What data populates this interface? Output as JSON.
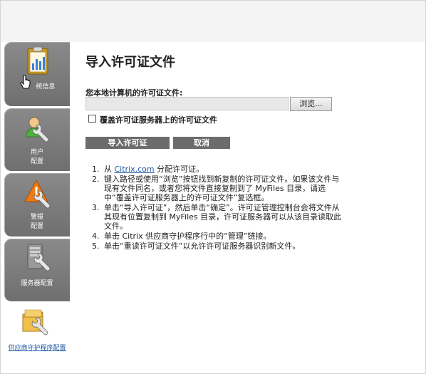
{
  "sidebar": {
    "items": [
      {
        "label": "统信息",
        "icon": "clipboard-chart-icon"
      },
      {
        "label1": "用户",
        "label2": "配置",
        "icon": "user-wrench-icon"
      },
      {
        "label1": "警报",
        "label2": "配置",
        "icon": "warning-wrench-icon"
      },
      {
        "label": "服务器配置",
        "icon": "server-wrench-icon"
      },
      {
        "label": "供应商守护程序配置",
        "icon": "folder-wrench-icon"
      }
    ]
  },
  "main": {
    "title": "导入许可证文件",
    "file_label": "您本地计算机的许可证文件:",
    "file_value": "",
    "browse_label": "浏览...",
    "overwrite_label": "覆盖许可证服务器上的许可证文件",
    "import_label": "导入许可证",
    "cancel_label": "取消",
    "steps": [
      {
        "num": "1.",
        "pre": "从 ",
        "link": "Citrix.com",
        "post": " 分配许可证。"
      },
      {
        "num": "2.",
        "text": "键入路径或使用“浏览”按钮找到新复制的许可证文件。如果该文件与现有文件同名，或者您将文件直接复制到了 MyFiles 目录，请选中“覆盖许可证服务器上的许可证文件”复选框。"
      },
      {
        "num": "3.",
        "text": "单击“导入许可证”，然后单击“确定”。许可证管理控制台会将文件从其现有位置复制到 MyFiles 目录，许可证服务器可以从该目录读取此文件。"
      },
      {
        "num": "4.",
        "text": "单击 Citrix 供应商守护程序行中的“管理”链接。"
      },
      {
        "num": "5.",
        "text": "单击“重读许可证文件”以允许许可证服务器识别新文件。"
      }
    ]
  }
}
